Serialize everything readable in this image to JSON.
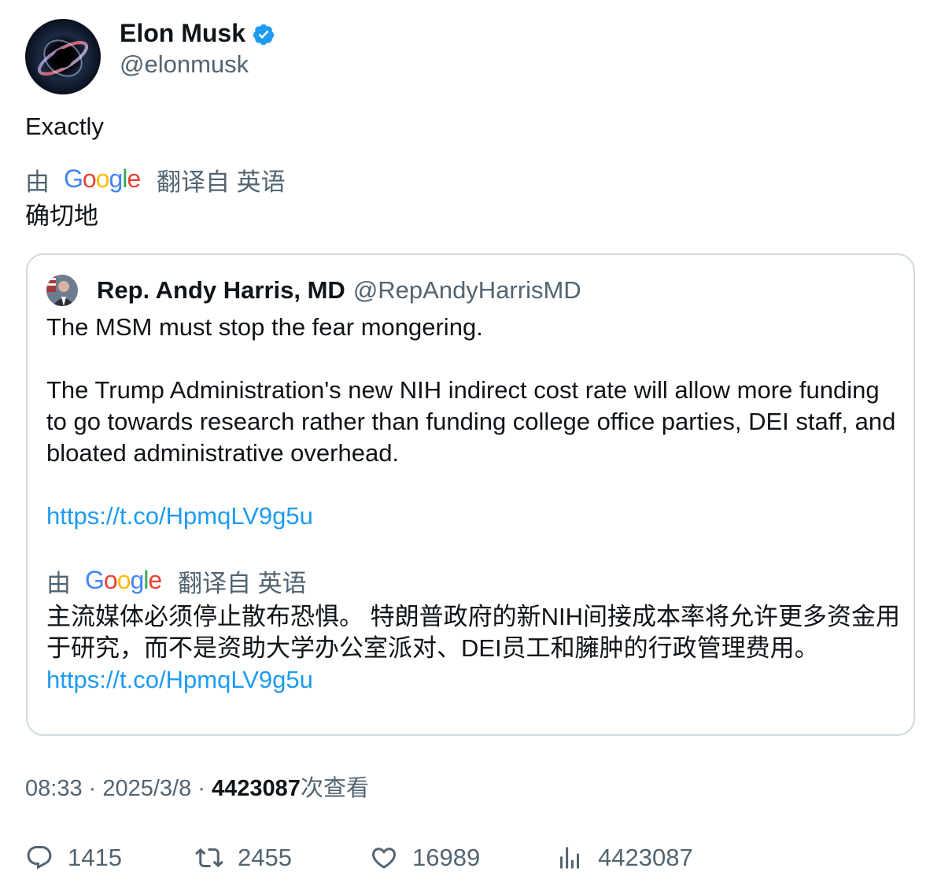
{
  "author": {
    "name": "Elon Musk",
    "handle": "@elonmusk",
    "verified": true
  },
  "tweet": {
    "text": "Exactly",
    "translate_by": "由",
    "translate_from": "翻译自 英语",
    "translated_text": "确切地"
  },
  "quote": {
    "name": "Rep. Andy Harris, MD",
    "handle": "@RepAndyHarrisMD",
    "line1": "The MSM must stop the fear mongering.",
    "line2": "The Trump Administration's new NIH indirect cost rate will allow more funding to go towards research rather than funding college office parties, DEI staff, and bloated administrative overhead.",
    "link": "https://t.co/HpmqLV9g5u",
    "translate_by": "由",
    "translate_from": "翻译自 英语",
    "translated_text": "主流媒体必须停止散布恐惧。 特朗普政府的新NIH间接成本率将允许更多资金用于研究，而不是资助大学办公室派对、DEI员工和臃肿的行政管理费用。",
    "translated_link": "https://t.co/HpmqLV9g5u"
  },
  "meta": {
    "time": "08:33",
    "sep1": " · ",
    "date": "2025/3/8",
    "sep2": " · ",
    "views": "4423087",
    "views_suffix": "次查看"
  },
  "actions": {
    "replies": "1415",
    "retweets": "2455",
    "likes": "16989",
    "views": "4423087"
  },
  "colors": {
    "link": "#1d9bf0",
    "secondary": "#536471",
    "primary": "#0f1419",
    "border": "#cfd9de"
  }
}
